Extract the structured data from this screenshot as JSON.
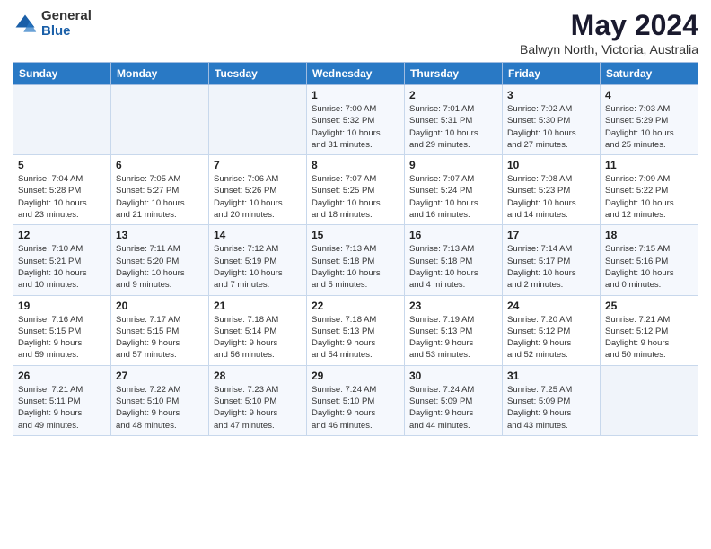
{
  "logo": {
    "general": "General",
    "blue": "Blue"
  },
  "title": "May 2024",
  "subtitle": "Balwyn North, Victoria, Australia",
  "weekdays": [
    "Sunday",
    "Monday",
    "Tuesday",
    "Wednesday",
    "Thursday",
    "Friday",
    "Saturday"
  ],
  "weeks": [
    [
      {
        "day": "",
        "info": ""
      },
      {
        "day": "",
        "info": ""
      },
      {
        "day": "",
        "info": ""
      },
      {
        "day": "1",
        "info": "Sunrise: 7:00 AM\nSunset: 5:32 PM\nDaylight: 10 hours\nand 31 minutes."
      },
      {
        "day": "2",
        "info": "Sunrise: 7:01 AM\nSunset: 5:31 PM\nDaylight: 10 hours\nand 29 minutes."
      },
      {
        "day": "3",
        "info": "Sunrise: 7:02 AM\nSunset: 5:30 PM\nDaylight: 10 hours\nand 27 minutes."
      },
      {
        "day": "4",
        "info": "Sunrise: 7:03 AM\nSunset: 5:29 PM\nDaylight: 10 hours\nand 25 minutes."
      }
    ],
    [
      {
        "day": "5",
        "info": "Sunrise: 7:04 AM\nSunset: 5:28 PM\nDaylight: 10 hours\nand 23 minutes."
      },
      {
        "day": "6",
        "info": "Sunrise: 7:05 AM\nSunset: 5:27 PM\nDaylight: 10 hours\nand 21 minutes."
      },
      {
        "day": "7",
        "info": "Sunrise: 7:06 AM\nSunset: 5:26 PM\nDaylight: 10 hours\nand 20 minutes."
      },
      {
        "day": "8",
        "info": "Sunrise: 7:07 AM\nSunset: 5:25 PM\nDaylight: 10 hours\nand 18 minutes."
      },
      {
        "day": "9",
        "info": "Sunrise: 7:07 AM\nSunset: 5:24 PM\nDaylight: 10 hours\nand 16 minutes."
      },
      {
        "day": "10",
        "info": "Sunrise: 7:08 AM\nSunset: 5:23 PM\nDaylight: 10 hours\nand 14 minutes."
      },
      {
        "day": "11",
        "info": "Sunrise: 7:09 AM\nSunset: 5:22 PM\nDaylight: 10 hours\nand 12 minutes."
      }
    ],
    [
      {
        "day": "12",
        "info": "Sunrise: 7:10 AM\nSunset: 5:21 PM\nDaylight: 10 hours\nand 10 minutes."
      },
      {
        "day": "13",
        "info": "Sunrise: 7:11 AM\nSunset: 5:20 PM\nDaylight: 10 hours\nand 9 minutes."
      },
      {
        "day": "14",
        "info": "Sunrise: 7:12 AM\nSunset: 5:19 PM\nDaylight: 10 hours\nand 7 minutes."
      },
      {
        "day": "15",
        "info": "Sunrise: 7:13 AM\nSunset: 5:18 PM\nDaylight: 10 hours\nand 5 minutes."
      },
      {
        "day": "16",
        "info": "Sunrise: 7:13 AM\nSunset: 5:18 PM\nDaylight: 10 hours\nand 4 minutes."
      },
      {
        "day": "17",
        "info": "Sunrise: 7:14 AM\nSunset: 5:17 PM\nDaylight: 10 hours\nand 2 minutes."
      },
      {
        "day": "18",
        "info": "Sunrise: 7:15 AM\nSunset: 5:16 PM\nDaylight: 10 hours\nand 0 minutes."
      }
    ],
    [
      {
        "day": "19",
        "info": "Sunrise: 7:16 AM\nSunset: 5:15 PM\nDaylight: 9 hours\nand 59 minutes."
      },
      {
        "day": "20",
        "info": "Sunrise: 7:17 AM\nSunset: 5:15 PM\nDaylight: 9 hours\nand 57 minutes."
      },
      {
        "day": "21",
        "info": "Sunrise: 7:18 AM\nSunset: 5:14 PM\nDaylight: 9 hours\nand 56 minutes."
      },
      {
        "day": "22",
        "info": "Sunrise: 7:18 AM\nSunset: 5:13 PM\nDaylight: 9 hours\nand 54 minutes."
      },
      {
        "day": "23",
        "info": "Sunrise: 7:19 AM\nSunset: 5:13 PM\nDaylight: 9 hours\nand 53 minutes."
      },
      {
        "day": "24",
        "info": "Sunrise: 7:20 AM\nSunset: 5:12 PM\nDaylight: 9 hours\nand 52 minutes."
      },
      {
        "day": "25",
        "info": "Sunrise: 7:21 AM\nSunset: 5:12 PM\nDaylight: 9 hours\nand 50 minutes."
      }
    ],
    [
      {
        "day": "26",
        "info": "Sunrise: 7:21 AM\nSunset: 5:11 PM\nDaylight: 9 hours\nand 49 minutes."
      },
      {
        "day": "27",
        "info": "Sunrise: 7:22 AM\nSunset: 5:10 PM\nDaylight: 9 hours\nand 48 minutes."
      },
      {
        "day": "28",
        "info": "Sunrise: 7:23 AM\nSunset: 5:10 PM\nDaylight: 9 hours\nand 47 minutes."
      },
      {
        "day": "29",
        "info": "Sunrise: 7:24 AM\nSunset: 5:10 PM\nDaylight: 9 hours\nand 46 minutes."
      },
      {
        "day": "30",
        "info": "Sunrise: 7:24 AM\nSunset: 5:09 PM\nDaylight: 9 hours\nand 44 minutes."
      },
      {
        "day": "31",
        "info": "Sunrise: 7:25 AM\nSunset: 5:09 PM\nDaylight: 9 hours\nand 43 minutes."
      },
      {
        "day": "",
        "info": ""
      }
    ]
  ]
}
